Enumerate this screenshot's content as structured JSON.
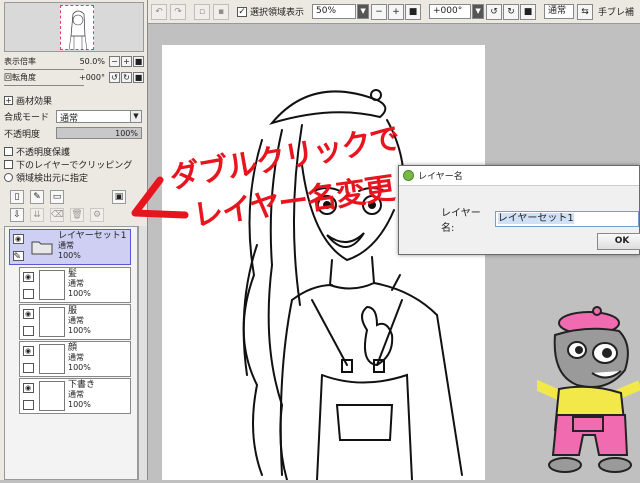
{
  "left_panel": {
    "display_scale_label": "表示倍率",
    "display_scale_value": "50.0%",
    "rotation_label": "回転角度",
    "rotation_value": "+000°",
    "effects_header": "画材効果",
    "blend_mode_label": "合成モード",
    "blend_mode_value": "通常",
    "opacity_label": "不透明度",
    "opacity_value": "100%",
    "protect_opacity": "不透明度保護",
    "clip_lower": "下のレイヤーでクリッピング",
    "selection_source": "領域検出元に指定"
  },
  "layers": [
    {
      "name": "レイヤーセット1",
      "mode": "通常",
      "opacity": "100%"
    },
    {
      "name": "髪",
      "mode": "通常",
      "opacity": "100%"
    },
    {
      "name": "服",
      "mode": "通常",
      "opacity": "100%"
    },
    {
      "name": "顔",
      "mode": "通常",
      "opacity": "100%"
    },
    {
      "name": "下書き",
      "mode": "通常",
      "opacity": "100%"
    }
  ],
  "toolbar": {
    "show_selection_label": "選択領域表示",
    "zoom_value": "50%",
    "rotation_value": "+000°",
    "mode_value": "通常",
    "tail_text": "手ブレ補"
  },
  "dialog": {
    "title": "レイヤー名",
    "field_label": "レイヤー名:",
    "field_value": "レイヤーセット1",
    "ok_label": "OK"
  },
  "annotation": {
    "line1": "ダブルクリックで",
    "line2": "レイヤー名変更",
    "color": "#e8141e"
  },
  "colors": {
    "selected_layer": "#cfcff4",
    "panel_bg": "#ece9e2",
    "canvas_bg": "#c0c0c0",
    "mascot_pink": "#f06bb0",
    "mascot_yellow": "#f2e84a"
  }
}
